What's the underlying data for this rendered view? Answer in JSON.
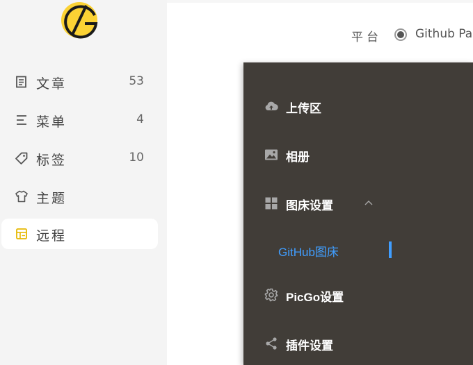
{
  "sidebar": {
    "items": [
      {
        "label": "文章",
        "count": "53",
        "icon": "document-icon"
      },
      {
        "label": "菜单",
        "count": "4",
        "icon": "menu-lines-icon"
      },
      {
        "label": "标签",
        "count": "10",
        "icon": "tag-icon"
      },
      {
        "label": "主题",
        "count": "",
        "icon": "shirt-icon"
      },
      {
        "label": "远程",
        "count": "",
        "icon": "remote-icon",
        "active": true
      }
    ]
  },
  "platform": {
    "label": "平台",
    "selected": "Github Pa"
  },
  "menu": {
    "upload": "上传区",
    "album": "相册",
    "bed_settings": "图床设置",
    "github_bed": "GitHub图床",
    "picgo_settings": "PicGo设置",
    "plugin_settings": "插件设置"
  },
  "colors": {
    "accent": "#409eff",
    "menu_bg": "#413d38",
    "logo_yellow": "#fbd234",
    "active_icon": "#e6b800"
  }
}
